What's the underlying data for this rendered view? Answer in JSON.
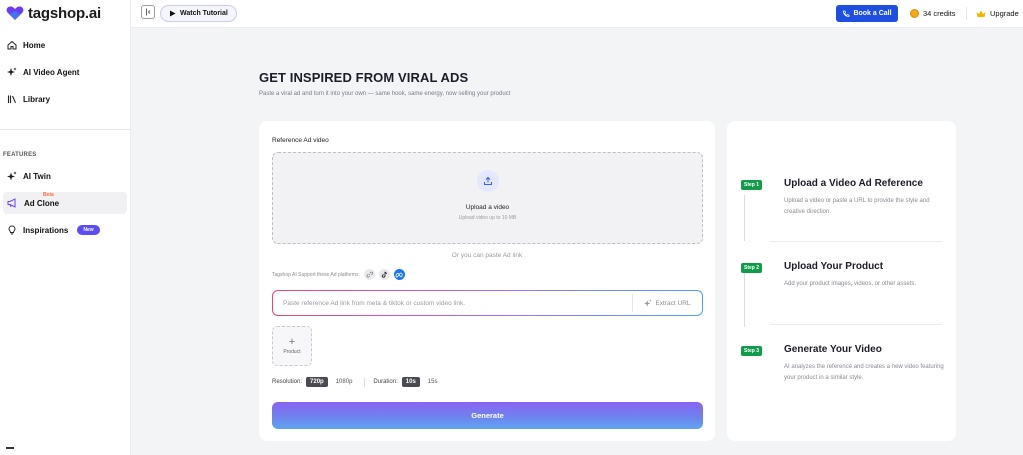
{
  "brand": {
    "name": "tagshop.ai",
    "accent": "#6c3cf5"
  },
  "sidebar": {
    "items": [
      {
        "label": "Home",
        "icon": "home-icon"
      },
      {
        "label": "AI Video Agent",
        "icon": "sparkle-icon"
      },
      {
        "label": "Library",
        "icon": "library-icon"
      }
    ],
    "section_label": "FEATURES",
    "features": [
      {
        "label": "AI Twin",
        "icon": "sparkle-icon"
      },
      {
        "label": "Ad Clone",
        "icon": "megaphone-icon",
        "badge": "Beta",
        "active": true
      },
      {
        "label": "Inspirations",
        "icon": "bulb-icon",
        "badge": "New"
      }
    ]
  },
  "topbar": {
    "watch_tutorial": "Watch Tutorial",
    "book_call": "Book a Call",
    "credits": "34 credits",
    "upgrade": "Upgrade"
  },
  "main": {
    "title": "GET INSPIRED FROM VIRAL ADS",
    "subtitle": "Paste a viral ad and turn it into your own — same hook, same energy, now selling your product",
    "reference_label": "Reference Ad video",
    "upload_title": "Upload a video",
    "upload_sub": "Upload video up to 10 MB",
    "or_paste": "Or you can paste Ad link",
    "platforms_label": "Tagshop AI Support these Ad platforms:",
    "link_placeholder": "Paste reference Ad link from meta & tiktok or custom video link.",
    "link_value": "",
    "extract_label": "Extract URL",
    "product_label": "Product",
    "resolution_label": "Resolution:",
    "resolution_options": [
      "720p",
      "1080p"
    ],
    "resolution_selected": "720p",
    "duration_label": "Duration:",
    "duration_options": [
      "10s",
      "15s"
    ],
    "duration_selected": "10s",
    "generate_label": "Generate"
  },
  "steps": [
    {
      "badge": "Step 1",
      "title": "Upload a Video Ad Reference",
      "desc": "Upload a video or paste a URL to provide the style and creative direction."
    },
    {
      "badge": "Step 2",
      "title": "Upload Your Product",
      "desc": "Add your product images, videos, or other assets."
    },
    {
      "badge": "Step 3",
      "title": "Generate Your Video",
      "desc": "AI analyzes the reference and creates a new video featuring your product in a similar style."
    }
  ],
  "colors": {
    "book_call_bg": "#1f4fe0",
    "step_badge": "#129b4a",
    "new_badge": "#5b4cf5",
    "beta_text": "#ff6b3d"
  }
}
